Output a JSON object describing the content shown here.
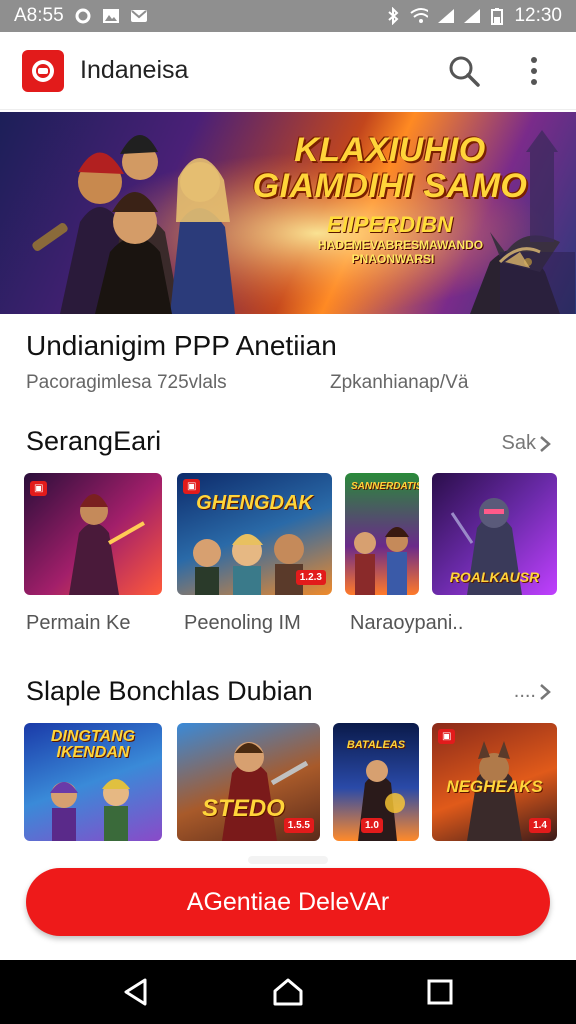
{
  "status_bar": {
    "time_left": "A8:55",
    "time_right": "12:30"
  },
  "app_bar": {
    "title": "Indaneisa"
  },
  "banner": {
    "title_line1": "KLAXIUHIO",
    "title_line2": "GIAMDIHI SAMO",
    "title_line3": "EIIPERDIBN",
    "title_line4": "HADEMEVABRESMAWANDO PNAONWARSI"
  },
  "headline": {
    "title": "Undianigim PPP Anetiian",
    "left_caption": "Pacoragimlesa 725vlals",
    "right_caption": "Zpkanhianap/Vä"
  },
  "section1": {
    "title": "SerangEari",
    "more_label": "Sak",
    "cards": [
      {
        "label": "Permain Ke",
        "thumb_text": "",
        "badge": "▣"
      },
      {
        "label": "Peenoling IM",
        "thumb_text": "GHENGDAK",
        "badge": "1.2.3"
      },
      {
        "label": "Naraoypani..",
        "thumb_text": "SANNERDATIS",
        "badge": ""
      },
      {
        "label": "",
        "thumb_text": "ROALKAUSR",
        "badge": ""
      }
    ]
  },
  "section2": {
    "title": "Slaple Bonchlas Dubian",
    "more_label": "....",
    "cards": [
      {
        "thumb_text": "DINGTANG IKENDAN",
        "badge": ""
      },
      {
        "thumb_text": "STEDO",
        "badge": "1.5.5"
      },
      {
        "thumb_text": "BATALEAS",
        "badge": "1.0"
      },
      {
        "thumb_text": "NEGHEAKS",
        "badge": "1.4"
      }
    ]
  },
  "cta": {
    "label": "AGentiae DeleVAr"
  },
  "icons": {
    "status": [
      "circle-icon",
      "image-icon",
      "mail-icon",
      "bluetooth-icon",
      "wifi-icon",
      "signal-icon",
      "battery-icon"
    ],
    "app_bar": [
      "app-logo-icon",
      "search-icon",
      "more-vertical-icon"
    ],
    "nav": [
      "back-icon",
      "home-icon",
      "recents-icon"
    ]
  },
  "colors": {
    "accent": "#ee1a1a",
    "status_bar": "#8f8f8f",
    "nav_bar": "#000000"
  }
}
